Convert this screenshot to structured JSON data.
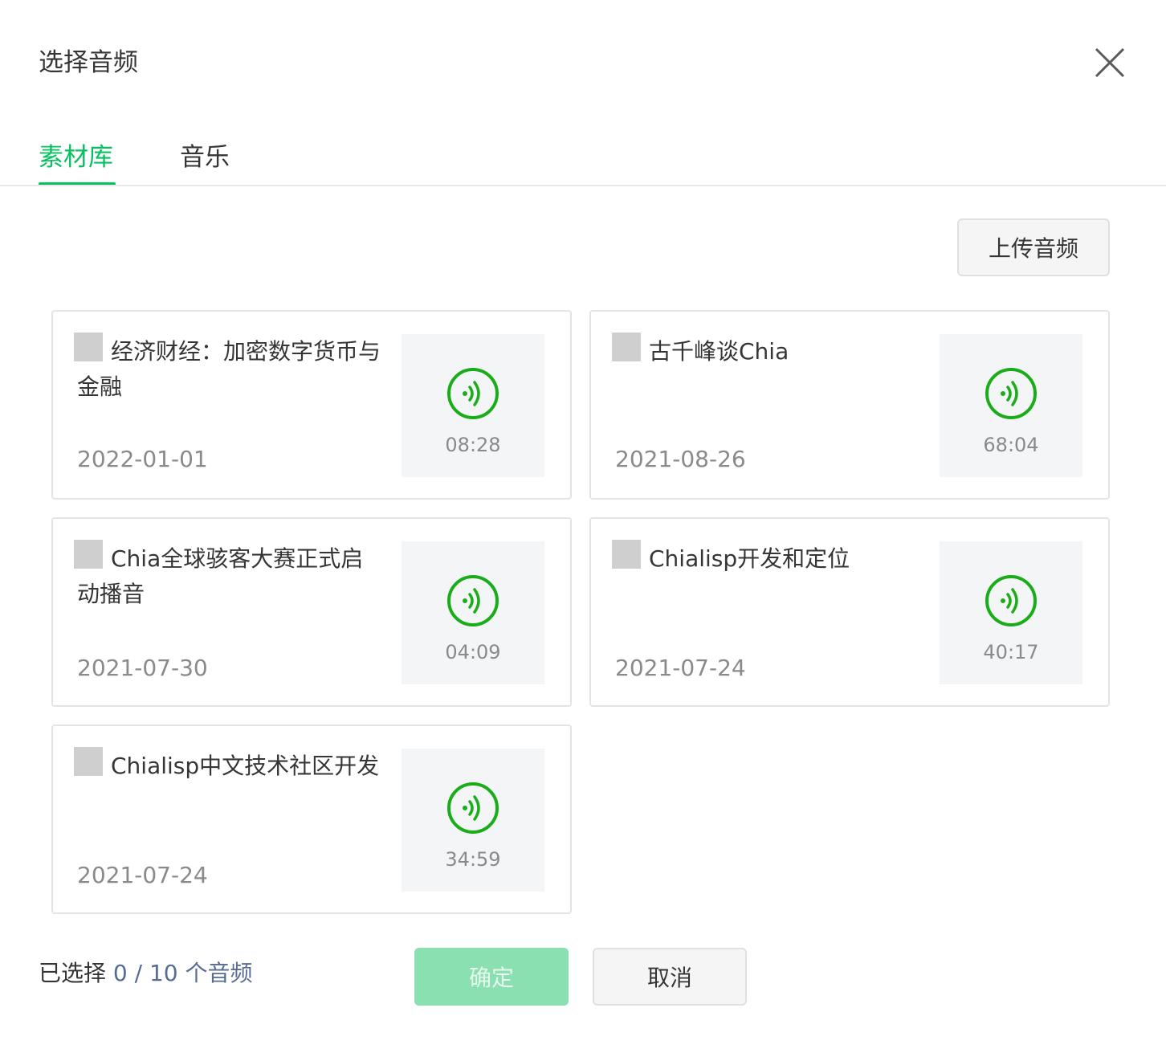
{
  "dialog": {
    "title": "选择音频"
  },
  "tabs": [
    {
      "label": "素材库",
      "active": true
    },
    {
      "label": "音乐",
      "active": false
    }
  ],
  "toolbar": {
    "upload_label": "上传音频"
  },
  "audio_items": [
    {
      "title": "经济财经：加密数字货币与金融",
      "date": "2022-01-01",
      "duration": "08:28",
      "checked": false
    },
    {
      "title": "古千峰谈Chia",
      "date": "2021-08-26",
      "duration": "68:04",
      "checked": false
    },
    {
      "title": "Chia全球骇客大赛正式启动播音",
      "date": "2021-07-30",
      "duration": "04:09",
      "checked": false
    },
    {
      "title": "Chialisp开发和定位",
      "date": "2021-07-24",
      "duration": "40:17",
      "checked": false
    },
    {
      "title": "Chialisp中文技术社区开发",
      "date": "2021-07-24",
      "duration": "34:59",
      "checked": false
    }
  ],
  "footer": {
    "selected_prefix": "已选择",
    "selected_count": "0 / 10 个音频",
    "confirm_label": "确定",
    "cancel_label": "取消"
  },
  "colors": {
    "accent": "#07c160",
    "accent_disabled": "#8ae0b0",
    "link": "#576b95"
  },
  "icons": {
    "close": "close-icon",
    "play": "audio-play-icon"
  }
}
